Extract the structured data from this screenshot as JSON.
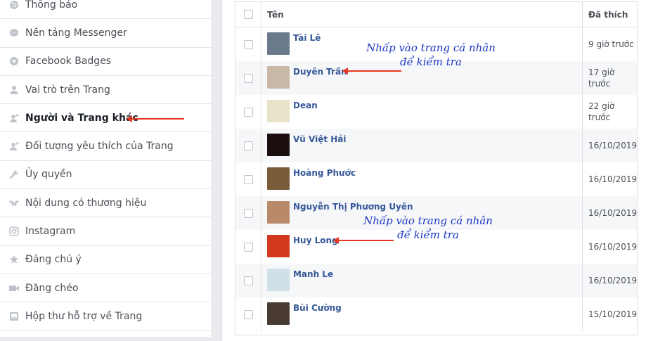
{
  "sidebar": {
    "items": [
      {
        "label": "Thông báo",
        "icon": "globe-icon"
      },
      {
        "label": "Nền tảng Messenger",
        "icon": "messenger-icon"
      },
      {
        "label": "Facebook Badges",
        "icon": "badge-icon"
      },
      {
        "label": "Vai trò trên Trang",
        "icon": "person-icon"
      },
      {
        "label": "Người và Trang khác",
        "icon": "person-add-icon"
      },
      {
        "label": "Đối tượng yêu thích của Trang",
        "icon": "person-add-icon"
      },
      {
        "label": "Ủy quyền",
        "icon": "wrench-icon"
      },
      {
        "label": "Nội dung có thương hiệu",
        "icon": "handshake-icon"
      },
      {
        "label": "Instagram",
        "icon": "instagram-icon"
      },
      {
        "label": "Đáng chú ý",
        "icon": "star-icon"
      },
      {
        "label": "Đăng chéo",
        "icon": "video-icon"
      },
      {
        "label": "Hộp thư hỗ trợ về Trang",
        "icon": "inbox-icon"
      }
    ]
  },
  "table": {
    "header_name": "Tên",
    "header_liked": "Đã thích",
    "rows": [
      {
        "name": "Tài Lê",
        "liked": "9 giờ trước",
        "avatar_color": "#6b7a8a"
      },
      {
        "name": "Duyên Trần",
        "liked": "17 giờ trước",
        "avatar_color": "#c9b8a8"
      },
      {
        "name": "Dean",
        "liked": "22 giờ trước",
        "avatar_color": "#e8e2c8"
      },
      {
        "name": "Vũ Việt Hải",
        "liked": "16/10/2019",
        "avatar_color": "#1a0e0e"
      },
      {
        "name": "Hoàng Phước",
        "liked": "16/10/2019",
        "avatar_color": "#7a5c3a"
      },
      {
        "name": "Nguyễn Thị Phương Uyên",
        "liked": "16/10/2019",
        "avatar_color": "#b88a6a"
      },
      {
        "name": "Huy Long",
        "liked": "16/10/2019",
        "avatar_color": "#d23a1e"
      },
      {
        "name": "Manh Le",
        "liked": "16/10/2019",
        "avatar_color": "#cfe0e8"
      },
      {
        "name": "Bùi Cường",
        "liked": "15/10/2019",
        "avatar_color": "#4a3a34"
      }
    ]
  },
  "annotations": {
    "note1_line1": "Nhấp vào trang cá nhân",
    "note1_line2": "để kiểm tra",
    "note2_line1": "Nhấp vào trang cá nhân",
    "note2_line2": "để kiểm tra"
  },
  "colors": {
    "link": "#365899",
    "annotation": "#1a36c4",
    "arrow": "#e8361e"
  }
}
